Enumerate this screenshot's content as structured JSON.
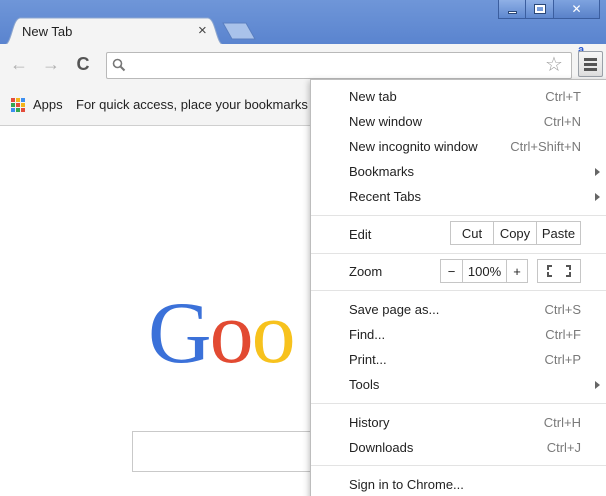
{
  "window": {
    "controls": [
      "minimize-icon",
      "maximize-icon",
      "close-icon"
    ],
    "accent_color": "#5a84cf"
  },
  "tabs": [
    {
      "title": "New Tab",
      "close_label": "×"
    }
  ],
  "toolbar": {
    "back_glyph": "←",
    "forward_glyph": "→",
    "reload_glyph": "C",
    "omnibox_value": "",
    "star_glyph": "☆",
    "extension_badge": "a"
  },
  "bookmarks_bar": {
    "apps_label": "Apps",
    "hint": "For quick access, place your bookmarks"
  },
  "page": {
    "logo_letters": [
      "G",
      "o",
      "o"
    ],
    "logo_colors": [
      "#3b71d9",
      "#e24a32",
      "#f7c21d"
    ]
  },
  "menu": {
    "new_tab": {
      "label": "New tab",
      "shortcut": "Ctrl+T"
    },
    "new_window": {
      "label": "New window",
      "shortcut": "Ctrl+N"
    },
    "new_incognito": {
      "label": "New incognito window",
      "shortcut": "Ctrl+Shift+N"
    },
    "bookmarks": {
      "label": "Bookmarks"
    },
    "recent_tabs": {
      "label": "Recent Tabs"
    },
    "edit": {
      "label": "Edit",
      "cut": "Cut",
      "copy": "Copy",
      "paste": "Paste"
    },
    "zoom": {
      "label": "Zoom",
      "minus": "−",
      "value": "100%",
      "plus": "+"
    },
    "save_page": {
      "label": "Save page as...",
      "shortcut": "Ctrl+S"
    },
    "find": {
      "label": "Find...",
      "shortcut": "Ctrl+F"
    },
    "print": {
      "label": "Print...",
      "shortcut": "Ctrl+P"
    },
    "tools": {
      "label": "Tools"
    },
    "history": {
      "label": "History",
      "shortcut": "Ctrl+H"
    },
    "downloads": {
      "label": "Downloads",
      "shortcut": "Ctrl+J"
    },
    "sign_in": {
      "label": "Sign in to Chrome..."
    }
  }
}
